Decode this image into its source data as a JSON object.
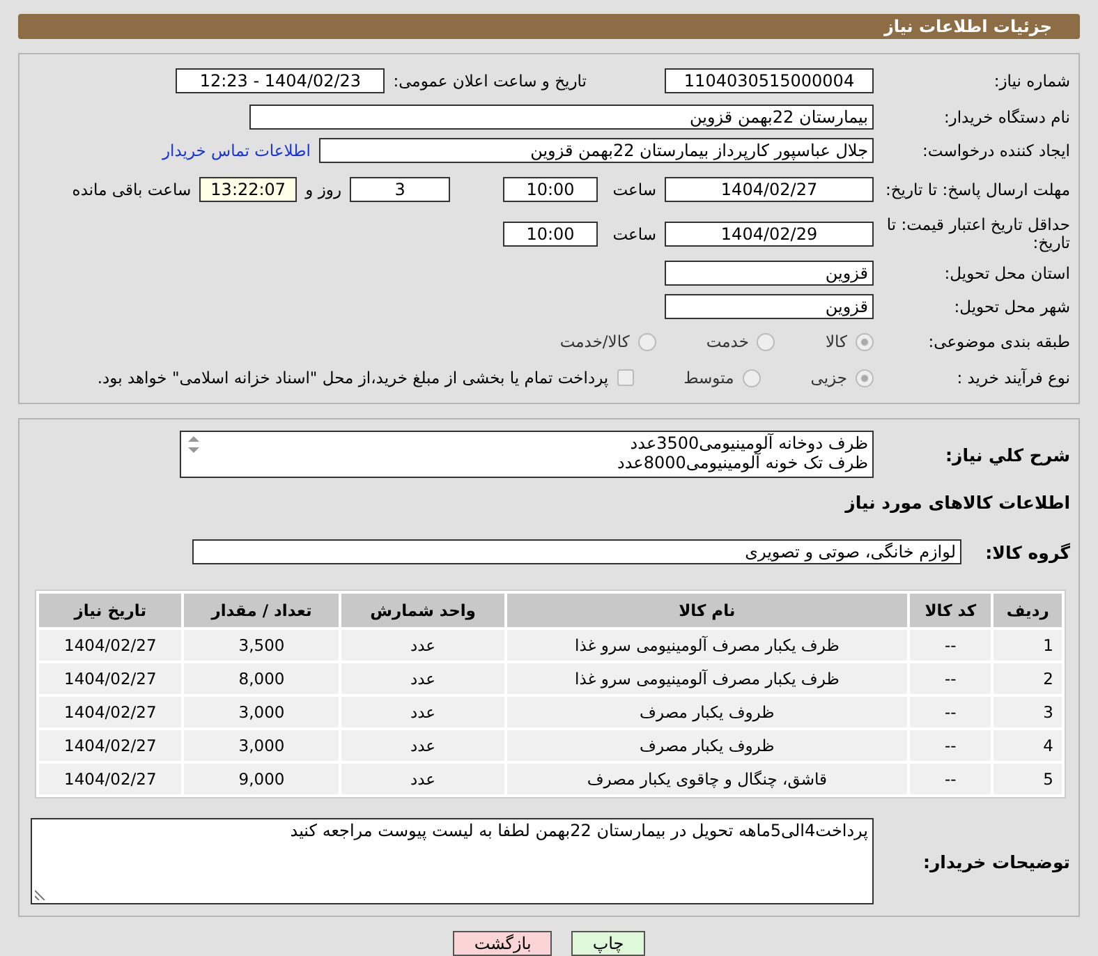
{
  "header": {
    "title": "جزئیات اطلاعات نیاز"
  },
  "need_number": {
    "label": "شماره نیاز:",
    "value": "1104030515000004"
  },
  "announce": {
    "label": "تاریخ و ساعت اعلان عمومی:",
    "value": "1404/02/23 - 12:23"
  },
  "buyer_org": {
    "label": "نام دستگاه خریدار:",
    "value": "بیمارستان 22بهمن قزوین"
  },
  "requester": {
    "label": "ایجاد کننده درخواست:",
    "value": "جلال عباسپور کارپرداز بیمارستان 22بهمن قزوین",
    "link": "اطلاعات تماس خریدار"
  },
  "reply_deadline": {
    "label": "مهلت ارسال پاسخ: تا تاریخ:",
    "date": "1404/02/27",
    "time_label": "ساعت",
    "time": "10:00",
    "days": "3",
    "days_label": "روز و",
    "remaining": "13:22:07",
    "remaining_label": "ساعت باقی مانده"
  },
  "price_validity": {
    "label": "حداقل تاریخ اعتبار قیمت: تا تاریخ:",
    "date": "1404/02/29",
    "time_label": "ساعت",
    "time": "10:00"
  },
  "province": {
    "label": "استان محل تحویل:",
    "value": "قزوین"
  },
  "city": {
    "label": "شهر محل تحویل:",
    "value": "قزوین"
  },
  "category": {
    "label": "طبقه بندی موضوعی:",
    "options": [
      {
        "label": "کالا",
        "selected": true
      },
      {
        "label": "خدمت",
        "selected": false
      },
      {
        "label": "کالا/خدمت",
        "selected": false
      }
    ]
  },
  "purchase_type": {
    "label": "نوع فرآیند خرید :",
    "options": [
      {
        "label": "جزیی",
        "selected": true
      },
      {
        "label": "متوسط",
        "selected": false
      }
    ],
    "treasury": {
      "checked": false,
      "label": "پرداخت تمام یا بخشی از مبلغ خرید،از محل \"اسناد خزانه اسلامی\" خواهد بود."
    }
  },
  "description": {
    "label": "شرح کلي نیاز:",
    "lines": [
      "ظرف دوخانه آلومینیومی3500عدد",
      "ظرف تک خونه آلومینیومی8000عدد"
    ]
  },
  "goods_heading": "اطلاعات کالاهای مورد نیاز",
  "goods_group": {
    "label": "گروه کالا:",
    "value": "لوازم خانگی، صوتی و تصویری"
  },
  "table": {
    "columns": [
      "ردیف",
      "کد کالا",
      "نام کالا",
      "واحد شمارش",
      "تعداد / مقدار",
      "تاریخ نیاز"
    ],
    "rows": [
      [
        "1",
        "--",
        "ظرف یکبار مصرف آلومینیومی سرو غذا",
        "عدد",
        "3,500",
        "1404/02/27"
      ],
      [
        "2",
        "--",
        "ظرف یکبار مصرف آلومینیومی سرو غذا",
        "عدد",
        "8,000",
        "1404/02/27"
      ],
      [
        "3",
        "--",
        "ظروف یکبار مصرف",
        "عدد",
        "3,000",
        "1404/02/27"
      ],
      [
        "4",
        "--",
        "ظروف یکبار مصرف",
        "عدد",
        "3,000",
        "1404/02/27"
      ],
      [
        "5",
        "--",
        "قاشق، چنگال و چاقوی یکبار مصرف",
        "عدد",
        "9,000",
        "1404/02/27"
      ]
    ]
  },
  "buyer_notes": {
    "label": "توضیحات خریدار:",
    "value": "پرداخت4الی5ماهه تحویل در بیمارستان 22بهمن لطفا به لیست پیوست مراجعه کنید"
  },
  "buttons": [
    {
      "kind": "print",
      "label": "چاپ"
    },
    {
      "kind": "back",
      "label": "بازگشت"
    }
  ]
}
